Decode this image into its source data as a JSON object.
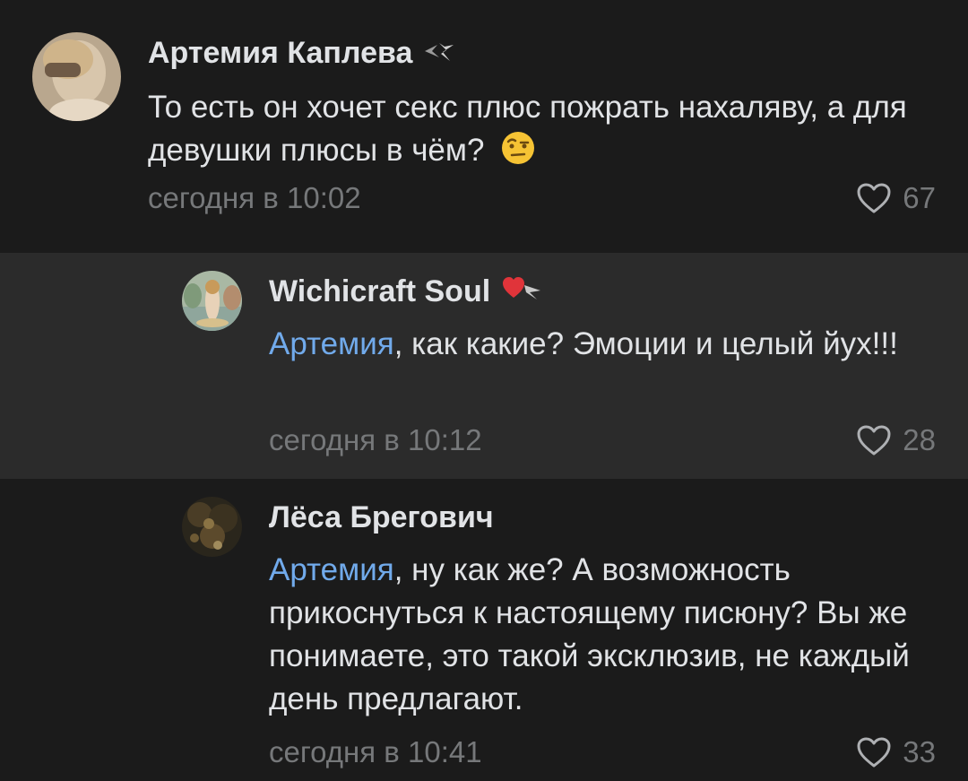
{
  "comments": [
    {
      "author": "Артемия Каплева",
      "text": "То есть он хочет секс плюс пожрать нахаляву, а для девушки плюсы в чём?",
      "emoji": "raised-eyebrow-emoji",
      "time": "сегодня в 10:02",
      "likes": "67"
    },
    {
      "author": "Wichicraft Soul",
      "mention": "Артемия",
      "text": ", как какие? Эмоции и целый йух!!!",
      "time": "сегодня в 10:12",
      "likes": "28"
    },
    {
      "author": "Лёса Брегович",
      "mention": "Артемия",
      "text": ", ну как же? А возможность прикоснуться к настоящему писюну? Вы же понимаете, это такой эксклюзив, не каждый день предлагают.",
      "time": "сегодня в 10:41",
      "likes": "33"
    }
  ],
  "colors": {
    "background": "#1b1b1b",
    "highlight_background": "#2b2b2b",
    "mention": "#71aaeb",
    "meta": "#76787a",
    "text": "#e1e3e6"
  }
}
